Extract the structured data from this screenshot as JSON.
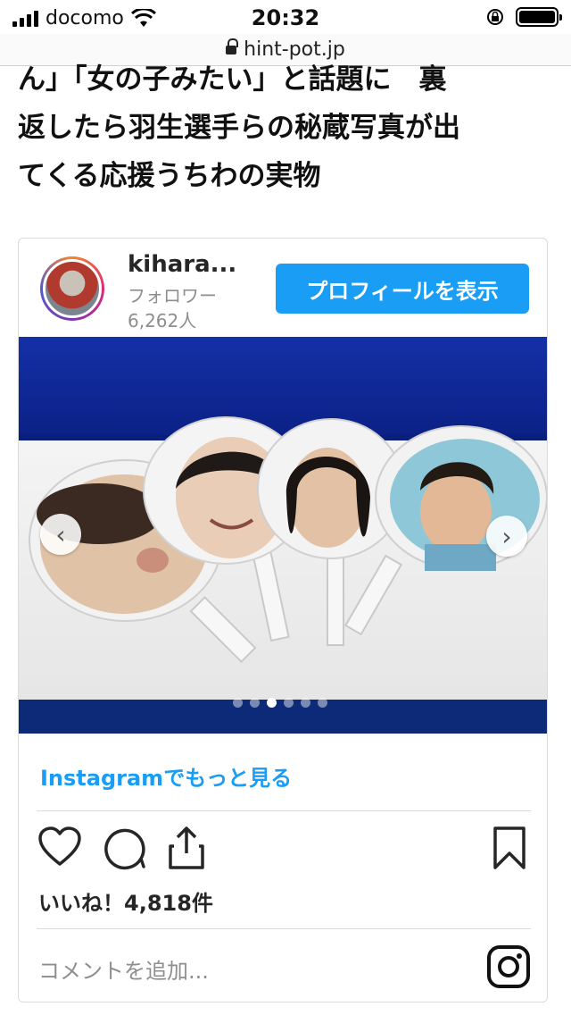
{
  "status_bar": {
    "carrier": "docomo",
    "time": "20:32",
    "url": "hint-pot.jp"
  },
  "article": {
    "headline_lines": [
      "ん」「女の子みたい」と話題に　裏",
      "返したら羽生選手らの秘蔵写真が出",
      "てくる応援うちわの実物"
    ]
  },
  "instagram_embed": {
    "username": "kihara...",
    "followers_label": "フォロワー",
    "followers_count": "6,262人",
    "profile_button": "プロフィールを表示",
    "carousel": {
      "slide_count": 6,
      "active_slide": 3,
      "prev_label": "‹",
      "next_label": "›"
    },
    "more_link": "Instagramでもっと見る",
    "likes": "いいね！4,818件",
    "comment_placeholder": "コメントを追加..."
  },
  "icons": {
    "like": "heart-icon",
    "comment": "comment-icon",
    "share": "share-icon",
    "save": "bookmark-icon",
    "instagram": "instagram-logo-icon"
  },
  "colors": {
    "accent": "#1a9ef5",
    "text": "#262626",
    "muted": "#8e8e8e",
    "border": "#dbdbdb"
  }
}
